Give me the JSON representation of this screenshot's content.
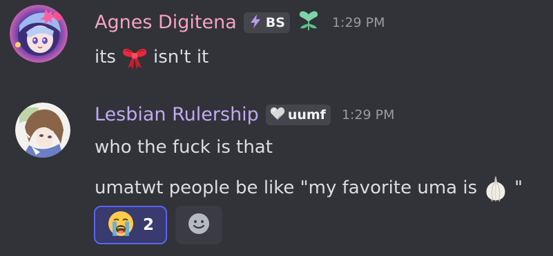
{
  "messages": [
    {
      "username": "Agnes Digitena",
      "username_color": "#f4a3c4",
      "tag": {
        "icon": "lightning-icon",
        "label": "BS"
      },
      "role_icon": "heart-leaf-icon",
      "timestamp": "1:29 PM",
      "lines": [
        {
          "before": "its",
          "emoji": "red-ribbon-emoji",
          "after": "isn't it"
        }
      ]
    },
    {
      "username": "Lesbian Rulership",
      "username_color": "#c2a9f2",
      "tag": {
        "icon": "heart-icon",
        "label": "uumf"
      },
      "timestamp": "1:29 PM",
      "lines": [
        {
          "text": "who the fuck is that"
        },
        {
          "before": "umatwt people be like \"my favorite uma is",
          "emoji": "garlic-emoji",
          "after": "\""
        }
      ],
      "reactions": [
        {
          "emoji": "loudly-crying-face-emoji",
          "count": "2",
          "active": true
        }
      ],
      "add_reaction_icon": "add-reaction-icon"
    }
  ],
  "colors": {
    "background": "#323339",
    "text": "#dbdee1",
    "timestamp": "#9a9ca3",
    "reaction_active_bg": "#393b6e",
    "reaction_active_border": "#5865f2"
  }
}
